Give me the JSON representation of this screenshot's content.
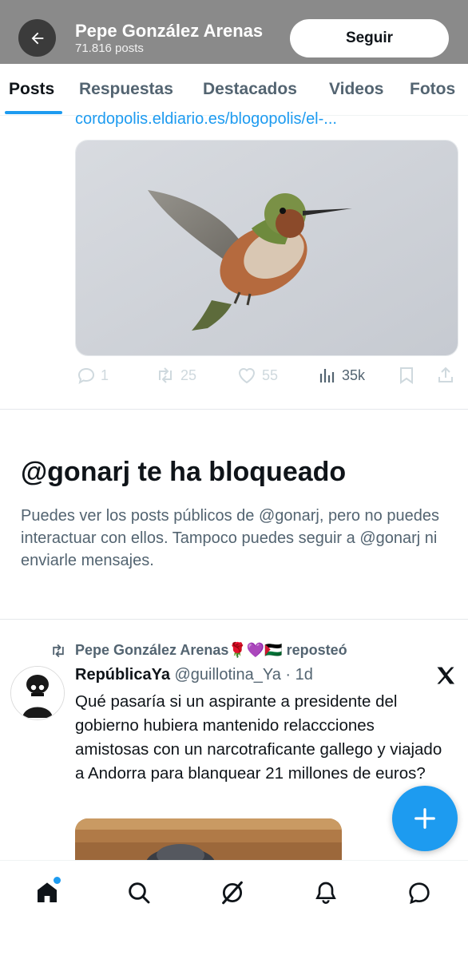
{
  "header": {
    "profile_name": "Pepe González Arenas",
    "post_count": "71.816 posts",
    "follow_label": "Seguir"
  },
  "tabs": [
    {
      "label": "Posts",
      "active": true
    },
    {
      "label": "Respuestas",
      "active": false
    },
    {
      "label": "Destacados",
      "active": false
    },
    {
      "label": "Videos",
      "active": false
    },
    {
      "label": "Fotos",
      "active": false
    }
  ],
  "post1": {
    "link_text": "cordopolis.eldiario.es/blogopolis/el-...",
    "media_alt": "hummingbird photo",
    "actions": {
      "replies": "1",
      "reposts": "25",
      "likes": "55",
      "views": "35k"
    }
  },
  "blocked": {
    "title": "@gonarj te ha bloqueado",
    "text": "Puedes ver los posts públicos de @gonarj, pero no puedes interactuar con ellos. Tampoco puedes seguir a @gonarj ni enviarle mensajes."
  },
  "repost": {
    "label": "Pepe González Arenas🌹💜🇵🇸 reposteó",
    "author_name": "RepúblicaYa",
    "author_handle": "@guillotina_Ya",
    "time": "· 1d",
    "text": "Qué pasaría si un aspirante a presidente del gobierno hubiera mantenido relaccciones amistosas con un narcotraficante gallego y viajado a Andorra para blanquear 21 millones de euros?"
  },
  "colors": {
    "accent": "#1d9bf0",
    "header_bg": "#8a8a8a",
    "text_primary": "#0f1419",
    "text_secondary": "#536471"
  },
  "nav": {
    "items": [
      "home-icon",
      "search-icon",
      "grok-icon",
      "notifications-icon",
      "messages-icon"
    ]
  }
}
